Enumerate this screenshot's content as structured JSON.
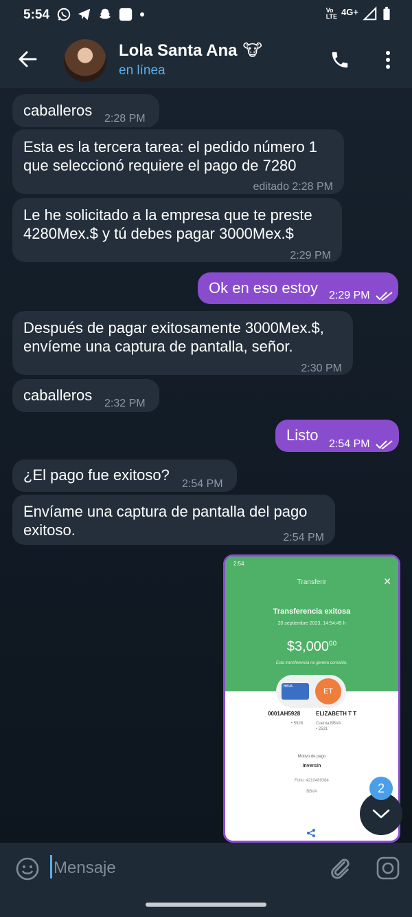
{
  "status_bar": {
    "time": "5:54",
    "network_top": "Vo",
    "network_bottom": "LTE",
    "network_type": "4G+",
    "icons": [
      "whatsapp-icon",
      "telegram-icon",
      "snapchat-icon",
      "square-app-icon",
      "dot-icon",
      "signal-icon",
      "battery-icon"
    ]
  },
  "header": {
    "contact_name": "Lola Santa Ana",
    "status": "en línea",
    "emoji": "🐮"
  },
  "messages": [
    {
      "direction": "in",
      "text": "caballeros",
      "time": "2:28 PM"
    },
    {
      "direction": "in",
      "text": "Esta es la tercera tarea: el pedido número 1\nque seleccionó requiere el pago de 7280",
      "time": "editado 2:28 PM"
    },
    {
      "direction": "in",
      "text": "Le he solicitado a la empresa que te preste\n4280Mex.$ y tú debes pagar 3000Mex.$",
      "time": "2:29 PM"
    },
    {
      "direction": "out",
      "text": "Ok en eso estoy",
      "time": "2:29 PM"
    },
    {
      "direction": "in",
      "text": "Después de pagar exitosamente 3000Mex.$,\nenvíeme una captura de pantalla, señor.",
      "time": "2:30 PM"
    },
    {
      "direction": "in",
      "text": "caballeros",
      "time": "2:32 PM"
    },
    {
      "direction": "out",
      "text": "Listo",
      "time": "2:54 PM"
    },
    {
      "direction": "in",
      "text": "¿El pago fue exitoso?",
      "time": "2:54 PM"
    },
    {
      "direction": "in",
      "text": "Envíame una captura de pantalla del pago\nexitoso.",
      "time": "2:54 PM"
    }
  ],
  "screenshot": {
    "status_time": "2:54",
    "title": "Transferir",
    "heading": "Transferencia exitosa",
    "date": "20 septiembre 2023, 14:54:49 h",
    "amount": "$3,000",
    "amount_cents": "00",
    "note": "Esta transferencia no genera comisión.",
    "card_label": "BBVA",
    "recipient_initials": "ET",
    "from_account": "0001AH5928",
    "from_sub": "• 5928",
    "to_name": "ELIZABETH T T",
    "to_sub1": "Cuenta BBVA",
    "to_sub2": "• 2531",
    "reason_label": "Motivo de pago",
    "reason_value": "Inversin",
    "folio": "Folio: 4210489384",
    "bank": "BBVA"
  },
  "scroll_fab": {
    "badge": "2"
  },
  "composer": {
    "placeholder": "Mensaje"
  }
}
